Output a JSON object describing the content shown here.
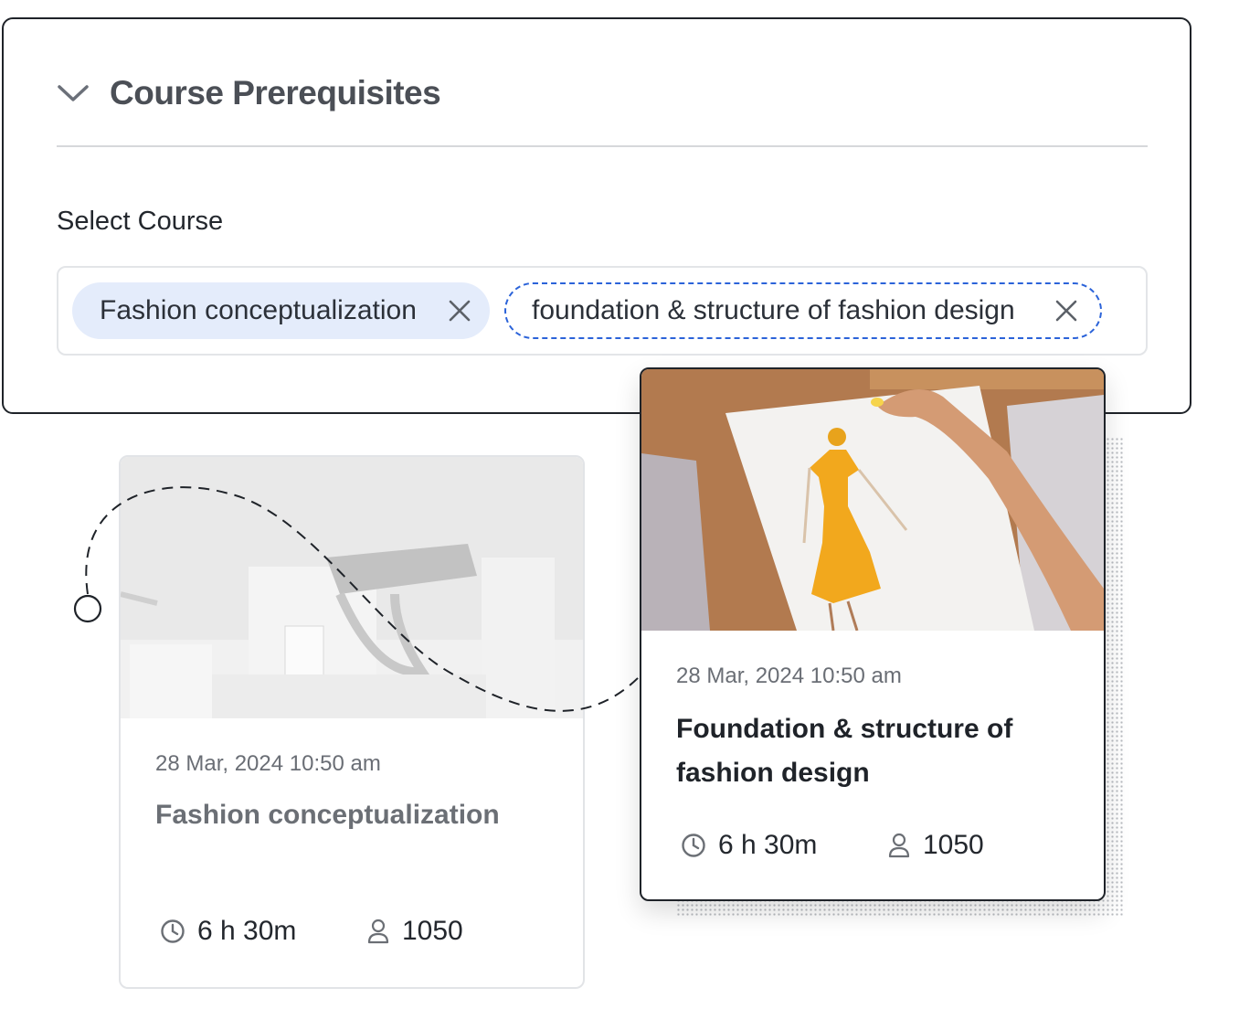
{
  "panel": {
    "title": "Course Prerequisites",
    "select_label": "Select Course",
    "chips": [
      {
        "label": "Fashion conceptualization",
        "state": "selected"
      },
      {
        "label": "foundation & structure of fashion design",
        "state": "focused"
      }
    ]
  },
  "cards": [
    {
      "date": "28 Mar, 2024 10:50 am",
      "title": "Fashion conceptualization",
      "duration": "6 h 30m",
      "students": "1050",
      "image": "bags-on-shelves-photo"
    },
    {
      "date": "28 Mar, 2024 10:50 am",
      "title": "Foundation & structure of fashion design",
      "duration": "6 h 30m",
      "students": "1050",
      "image": "fashion-sketch-photo"
    }
  ],
  "colors": {
    "accent": "#2b63d9",
    "chip_bg": "#e4ecfb",
    "dress": "#f2a81d"
  },
  "icons": [
    "chevron-down-icon",
    "close-icon",
    "clock-icon",
    "user-icon"
  ]
}
